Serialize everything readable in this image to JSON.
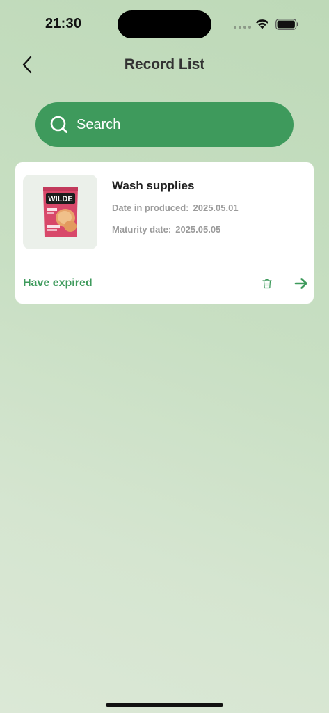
{
  "status_bar": {
    "time": "21:30"
  },
  "header": {
    "title": "Record List",
    "back_icon": "chevron-left-icon"
  },
  "search": {
    "placeholder": "Search",
    "icon": "search-icon"
  },
  "records": [
    {
      "name": "Wash supplies",
      "produced_label": "Date in produced:",
      "produced_value": "2025.05.01",
      "maturity_label": "Maturity date:",
      "maturity_value": "2025.05.05",
      "status": "Have expired",
      "delete_icon": "trash-icon",
      "open_icon": "arrow-right-icon",
      "thumbnail_brand_text": "WILDE"
    }
  ],
  "colors": {
    "accent": "#3e9a5c",
    "card_bg": "#ffffff",
    "muted_text": "#9b9b9b",
    "title_text": "#333333"
  }
}
